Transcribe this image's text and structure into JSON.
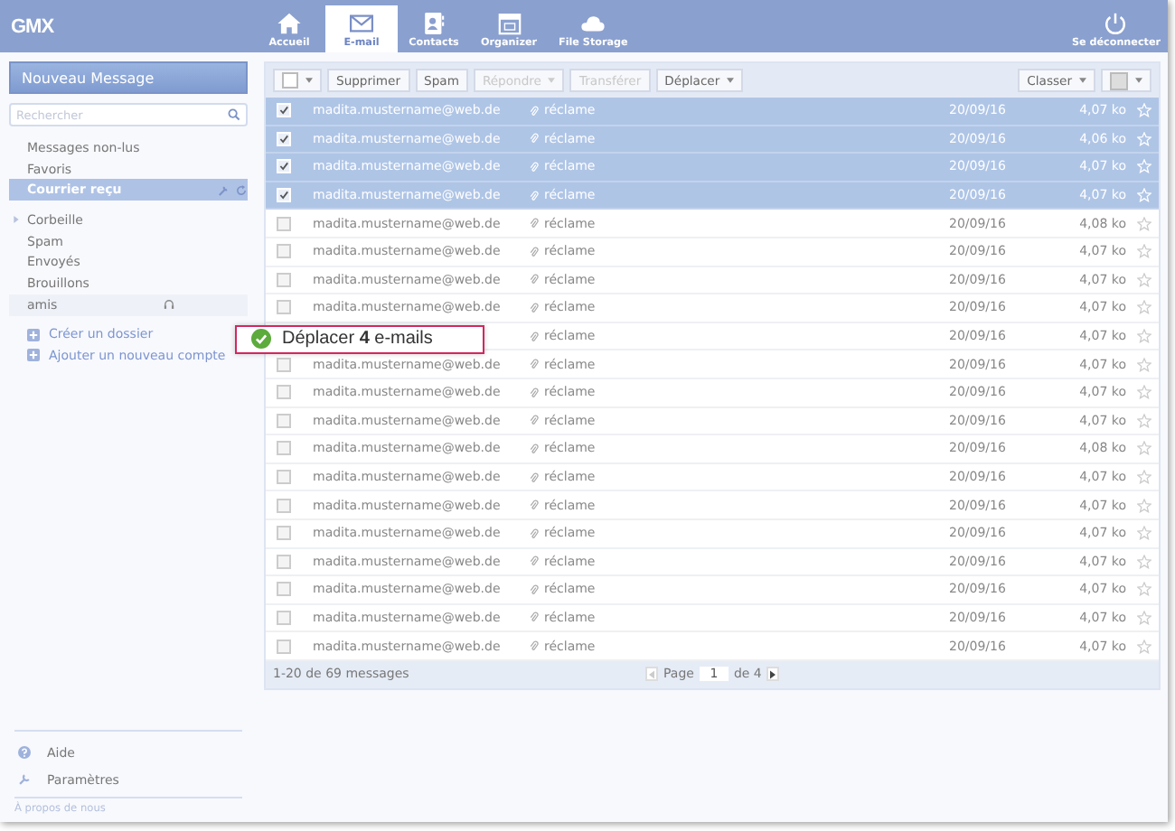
{
  "brand": "GMX",
  "nav": [
    {
      "label": "Accueil",
      "selected": false
    },
    {
      "label": "E-mail",
      "selected": true
    },
    {
      "label": "Contacts",
      "selected": false
    },
    {
      "label": "Organizer",
      "selected": false
    },
    {
      "label": "File Storage",
      "selected": false
    }
  ],
  "logout": "Se déconnecter",
  "sidebar": {
    "compose": "Nouveau Message",
    "search": {
      "placeholder": "Rechercher"
    },
    "quick": [
      {
        "label": "Messages non-lus",
        "selected": false
      },
      {
        "label": "Favoris",
        "selected": false
      },
      {
        "label": "Courrier reçu",
        "selected": true
      }
    ],
    "folders": [
      {
        "label": "Corbeille",
        "expanded": false
      },
      {
        "label": "Spam"
      },
      {
        "label": "Envoyés"
      },
      {
        "label": "Brouillons"
      },
      {
        "label": "amis",
        "shared": true
      }
    ],
    "actions": [
      "Créer un dossier",
      "Ajouter un nouveau compte"
    ],
    "help": "Aide",
    "settings": "Paramètres",
    "about": "À propos de nous"
  },
  "toolbar": {
    "buttons": [
      {
        "label": "Supprimer",
        "disabled": false,
        "dropdown": false
      },
      {
        "label": "Spam",
        "disabled": false,
        "dropdown": false
      },
      {
        "label": "Répondre",
        "disabled": true,
        "dropdown": true
      },
      {
        "label": "Transférer",
        "disabled": true,
        "dropdown": false
      },
      {
        "label": "Déplacer",
        "disabled": false,
        "dropdown": true
      }
    ],
    "sort": "Classer"
  },
  "rows": [
    {
      "checked": true,
      "sender": "madita.mustername@web.de",
      "subject": "réclame",
      "date": "20/09/16",
      "size": "4,07 ko",
      "starred": false
    },
    {
      "checked": true,
      "sender": "madita.mustername@web.de",
      "subject": "réclame",
      "date": "20/09/16",
      "size": "4,06 ko",
      "starred": false
    },
    {
      "checked": true,
      "sender": "madita.mustername@web.de",
      "subject": "réclame",
      "date": "20/09/16",
      "size": "4,07 ko",
      "starred": false
    },
    {
      "checked": true,
      "sender": "madita.mustername@web.de",
      "subject": "réclame",
      "date": "20/09/16",
      "size": "4,07 ko",
      "starred": false
    },
    {
      "checked": false,
      "sender": "madita.mustername@web.de",
      "subject": "réclame",
      "date": "20/09/16",
      "size": "4,08 ko",
      "starred": false
    },
    {
      "checked": false,
      "sender": "madita.mustername@web.de",
      "subject": "réclame",
      "date": "20/09/16",
      "size": "4,07 ko",
      "starred": false
    },
    {
      "checked": false,
      "sender": "madita.mustername@web.de",
      "subject": "réclame",
      "date": "20/09/16",
      "size": "4,07 ko",
      "starred": false
    },
    {
      "checked": false,
      "sender": "madita.mustername@web.de",
      "subject": "réclame",
      "date": "20/09/16",
      "size": "4,07 ko",
      "starred": false
    },
    {
      "subject": "réclame",
      "date": "20/09/16",
      "size": "4,07 ko",
      "starred": false
    },
    {
      "checked": false,
      "sender": "madita.mustername@web.de",
      "subject": "réclame",
      "date": "20/09/16",
      "size": "4,07 ko",
      "starred": false
    },
    {
      "checked": false,
      "sender": "madita.mustername@web.de",
      "subject": "réclame",
      "date": "20/09/16",
      "size": "4,07 ko",
      "starred": false
    },
    {
      "checked": false,
      "sender": "madita.mustername@web.de",
      "subject": "réclame",
      "date": "20/09/16",
      "size": "4,07 ko",
      "starred": false
    },
    {
      "checked": false,
      "sender": "madita.mustername@web.de",
      "subject": "réclame",
      "date": "20/09/16",
      "size": "4,08 ko",
      "starred": false
    },
    {
      "checked": false,
      "sender": "madita.mustername@web.de",
      "subject": "réclame",
      "date": "20/09/16",
      "size": "4,07 ko",
      "starred": false
    },
    {
      "checked": false,
      "sender": "madita.mustername@web.de",
      "subject": "réclame",
      "date": "20/09/16",
      "size": "4,07 ko",
      "starred": false
    },
    {
      "checked": false,
      "sender": "madita.mustername@web.de",
      "subject": "réclame",
      "date": "20/09/16",
      "size": "4,07 ko",
      "starred": false
    },
    {
      "checked": false,
      "sender": "madita.mustername@web.de",
      "subject": "réclame",
      "date": "20/09/16",
      "size": "4,07 ko",
      "starred": false
    },
    {
      "checked": false,
      "sender": "madita.mustername@web.de",
      "subject": "réclame",
      "date": "20/09/16",
      "size": "4,07 ko",
      "starred": false
    },
    {
      "checked": false,
      "sender": "madita.mustername@web.de",
      "subject": "réclame",
      "date": "20/09/16",
      "size": "4,07 ko",
      "starred": false
    },
    {
      "checked": false,
      "sender": "madita.mustername@web.de",
      "subject": "réclame",
      "date": "20/09/16",
      "size": "4,07 ko",
      "starred": false
    }
  ],
  "footer": {
    "count": "1-20 de 69 messages",
    "page_label": "Page",
    "page": "1",
    "of": "de 4"
  },
  "toast": "Déplacer **4** e-mails"
}
